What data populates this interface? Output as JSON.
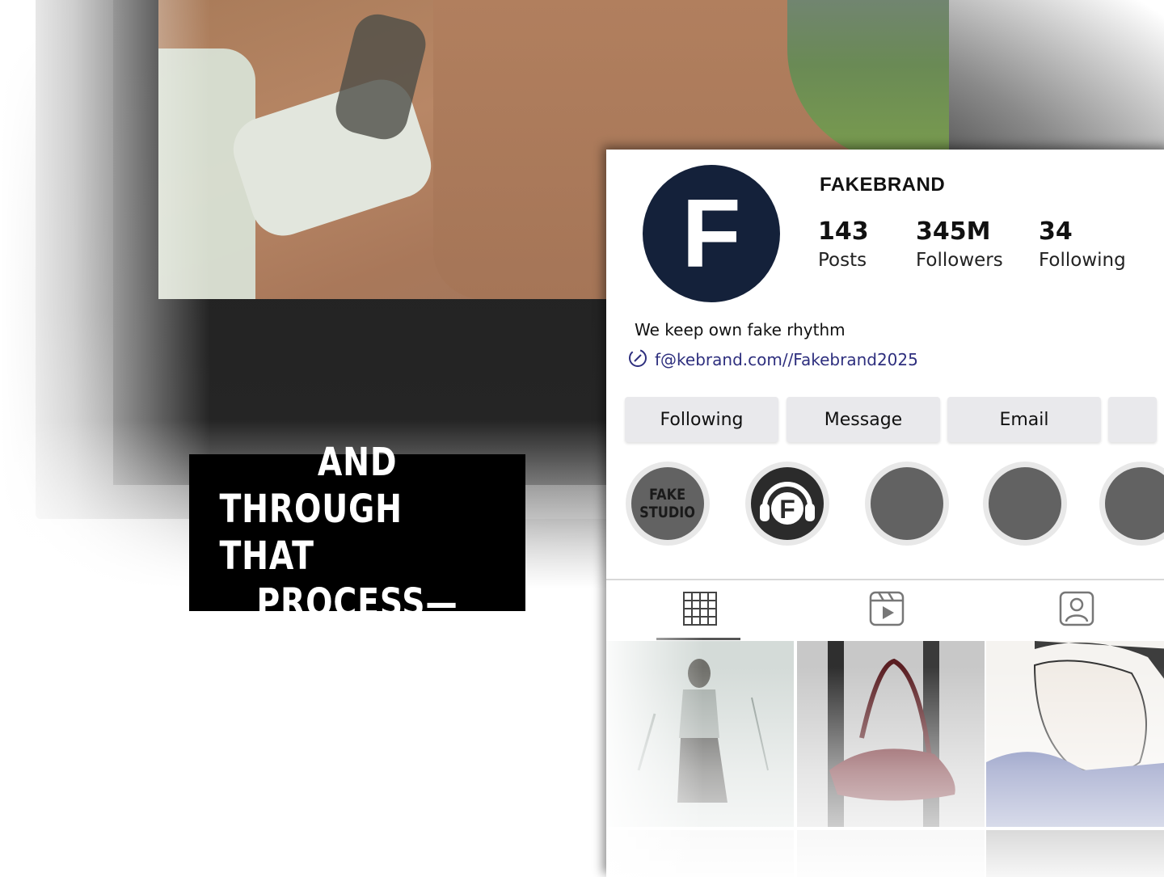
{
  "caption": {
    "lines": [
      "AND",
      "THROUGH THAT",
      "PROCESS—"
    ]
  },
  "profile": {
    "username": "FAKEBRAND",
    "avatar_letter": "F",
    "stats": {
      "posts": {
        "value": "143",
        "label": "Posts"
      },
      "followers": {
        "value": "345M",
        "label": "Followers"
      },
      "following": {
        "value": "34",
        "label": "Following"
      }
    },
    "bio": "We keep own fake rhythm",
    "link": "f@kebrand.com//Fakebrand2025",
    "link_icon": "link-icon"
  },
  "buttons": {
    "following": "Following",
    "message": "Message",
    "email": "Email"
  },
  "highlights": [
    {
      "line1": "FAKE",
      "line2": "STUDIO"
    },
    {
      "icon": "headphones-f-icon",
      "letter": "F"
    }
  ],
  "tabs": {
    "grid_icon": "grid-icon",
    "reels_icon": "reels-icon",
    "tagged_icon": "tagged-user-icon"
  },
  "colors": {
    "avatar_bg": "#14213a",
    "button_bg": "#e9e9ec",
    "link": "#2e2f7e",
    "caption_bg": "#000000"
  }
}
